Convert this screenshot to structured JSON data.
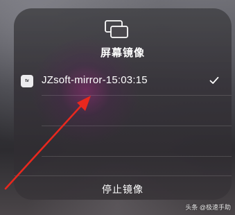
{
  "panel": {
    "title": "屏幕镜像",
    "icon": "screen-mirroring-icon"
  },
  "device": {
    "logo_text": " tv",
    "name": "JZsoft-mirror-15:03:15",
    "selected": true,
    "check_icon": "checkmark-icon"
  },
  "stop": {
    "label": "停止镜像"
  },
  "watermark": {
    "text": "头条 @极速手助"
  },
  "colors": {
    "annotation_arrow": "#e8281e",
    "text": "#ffffff"
  }
}
